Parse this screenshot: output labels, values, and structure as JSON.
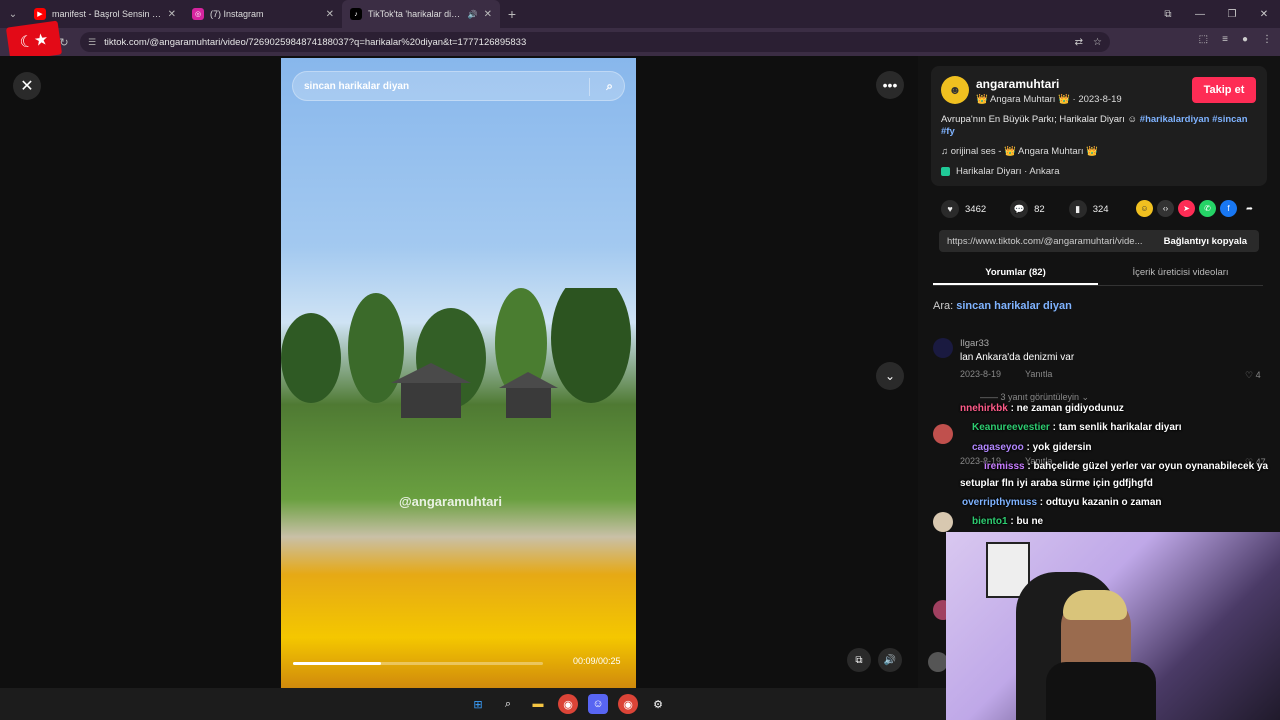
{
  "browser": {
    "tabs": [
      {
        "title": "manifest - Başrol Sensin | Officia",
        "favicon": "youtube-icon",
        "color": "#ff0000"
      },
      {
        "title": "(7) Instagram",
        "favicon": "instagram-icon",
        "color": "#d6249f"
      },
      {
        "title": "TikTok'ta 'harikalar diyan' b",
        "favicon": "tiktok-icon",
        "color": "#000000",
        "active": true
      }
    ],
    "url": "tiktok.com/@angaramuhtari/video/7269025984874188037?q=harikalar%20diyan&t=1777126895833"
  },
  "video": {
    "search_placeholder": "sincan harikalar diyan",
    "watermark": "@angaramuhtari",
    "time": "00:09/00:25",
    "progress": 0.35
  },
  "author": {
    "username": "angaramuhtari",
    "nickname": "👑 Angara Muhtarı 👑 · 2023-8-19",
    "follow_label": "Takip et",
    "description": "Avrupa'nın En Büyük Parkı; Harikalar Diyarı ☺",
    "tags": "#harikalardiyan #sincan #fy",
    "music": "♫  orijinal ses - 👑 Angara Muhtarı 👑",
    "place": "Harikalar Diyarı · Ankara"
  },
  "stats": {
    "likes": "3462",
    "comments": "82",
    "saves": "324"
  },
  "link": {
    "url": "https://www.tiktok.com/@angaramuhtari/vide...",
    "copy_label": "Bağlantıyı kopyala"
  },
  "panel_tabs": {
    "comments": "Yorumlar (82)",
    "creator_videos": "İçerik üreticisi videoları"
  },
  "related": {
    "prefix": "Ara: ",
    "query": "sincan harikalar diyan"
  },
  "comments": [
    {
      "user": "Ilgar33",
      "text": "lan Ankara'da denizmi var",
      "date": "2023-8-19",
      "reply": "Yanıtla",
      "likes": "4",
      "more": "—— 3 yanıt görüntüleyin ⌄"
    },
    {
      "user": "",
      "text": "",
      "date": "2023-8-19",
      "reply": "Yanıtla",
      "likes": "47"
    }
  ],
  "chat": [
    {
      "user": "nnehirkbk",
      "text": " : ne zaman gidiyodunuz",
      "color": "#ff5c8a"
    },
    {
      "user": "Keanureevestier",
      "text": " : tam senlik harikalar diyarı",
      "color": "#2ecc71"
    },
    {
      "user": "cagaseyoo",
      "text": " : yok gidersin",
      "color": "#b388ff"
    },
    {
      "user": "iremisss",
      "text": " : bahçelide güzel yerler var oyun oynanabilecek ya",
      "color": "#c77dff"
    },
    {
      "user": "",
      "text": "setuplar fln iyi araba sürme için gdfjhgfd",
      "color": "#ffffff"
    },
    {
      "user": "overripthymuss",
      "text": " : odtuyu kazanin o zaman",
      "color": "#7fb3ff"
    },
    {
      "user": "biento1",
      "text": " : bu ne",
      "color": "#2ecc71"
    }
  ]
}
